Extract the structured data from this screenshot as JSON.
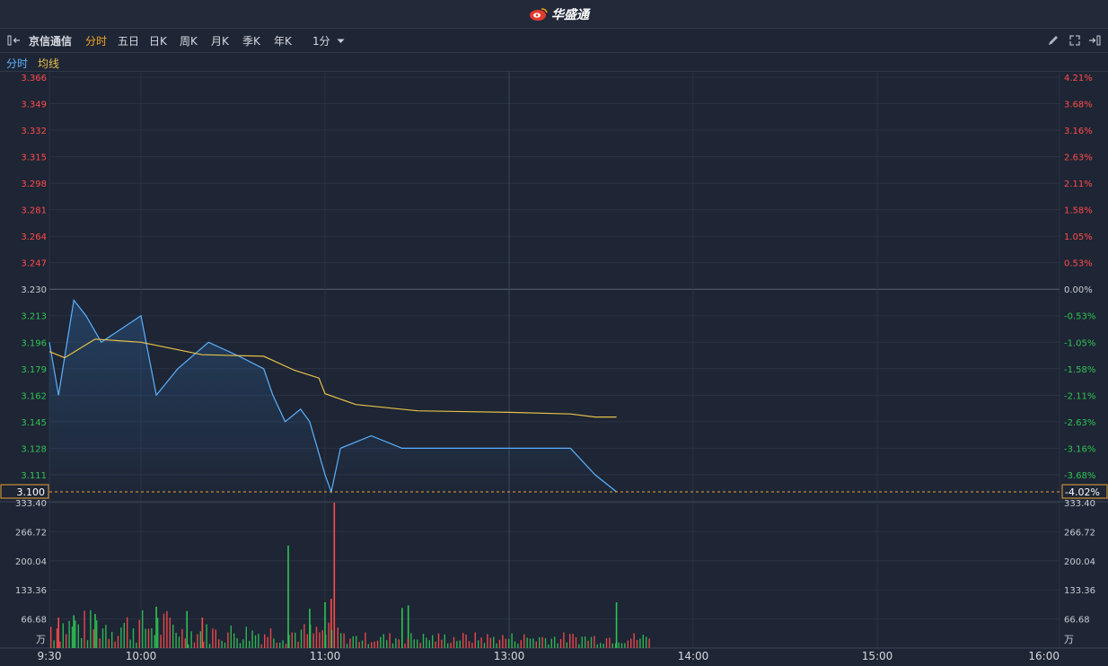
{
  "app": {
    "brand": "华盛通"
  },
  "toolbar": {
    "stock_name": "京信通信",
    "tabs": [
      "分时",
      "五日",
      "日K",
      "周K",
      "月K",
      "季K",
      "年K"
    ],
    "active_tab": "分时",
    "interval": "1分"
  },
  "legend": {
    "intraday": "分时",
    "average": "均线"
  },
  "colors": {
    "background": "#1e2534",
    "price_line": "#5bb2ff",
    "avg_line": "#e6c14b",
    "up": "#ff4b4b",
    "down": "#2fc455",
    "active_tab": "#f5a623",
    "current_price": "#e8a33a"
  },
  "chart_data": [
    {
      "type": "line",
      "series": [
        {
          "name": "分时",
          "x": [
            "9:30",
            "9:33",
            "9:38",
            "9:42",
            "9:47",
            "10:00",
            "10:05",
            "10:12",
            "10:22",
            "10:32",
            "10:40",
            "10:43",
            "10:47",
            "10:52",
            "10:55",
            "11:00",
            "11:02",
            "11:05",
            "11:15",
            "11:25",
            "11:30",
            "13:00",
            "13:20",
            "13:28",
            "13:35"
          ],
          "values": [
            3.196,
            3.162,
            3.223,
            3.213,
            3.196,
            3.213,
            3.162,
            3.179,
            3.196,
            3.187,
            3.179,
            3.162,
            3.145,
            3.153,
            3.145,
            3.111,
            3.1,
            3.128,
            3.136,
            3.128,
            3.128,
            3.128,
            3.128,
            3.111,
            3.1
          ]
        },
        {
          "name": "均线",
          "x": [
            "9:30",
            "9:35",
            "9:45",
            "10:00",
            "10:20",
            "10:40",
            "10:50",
            "10:58",
            "11:00",
            "11:10",
            "11:30",
            "13:00",
            "13:20",
            "13:28",
            "13:35"
          ],
          "values": [
            3.19,
            3.186,
            3.198,
            3.196,
            3.188,
            3.187,
            3.178,
            3.173,
            3.163,
            3.156,
            3.152,
            3.151,
            3.15,
            3.148,
            3.148
          ]
        }
      ],
      "y_ticks_left": [
        "3.366",
        "3.349",
        "3.332",
        "3.315",
        "3.298",
        "3.281",
        "3.264",
        "3.247",
        "3.230",
        "3.213",
        "3.196",
        "3.179",
        "3.162",
        "3.145",
        "3.128",
        "3.111"
      ],
      "y_ticks_right": [
        "4.21%",
        "3.68%",
        "3.16%",
        "2.63%",
        "2.11%",
        "1.58%",
        "1.05%",
        "0.53%",
        "0.00%",
        "-0.53%",
        "-1.05%",
        "-1.58%",
        "-2.11%",
        "-2.63%",
        "-3.16%",
        "-3.68%"
      ],
      "ylim": [
        3.1,
        3.366
      ],
      "prev_close": 3.23,
      "current_price": "3.100",
      "current_change": "-4.02%",
      "grid": true
    },
    {
      "type": "bar",
      "unit": "万",
      "y_ticks": [
        "333.40",
        "266.72",
        "200.04",
        "133.36",
        "66.68"
      ],
      "ylim": [
        0,
        333.4
      ],
      "x_ticks": [
        "9:30",
        "10:00",
        "11:00",
        "13:00",
        "14:00",
        "15:00",
        "16:00"
      ],
      "bars": [
        {
          "x": "10:48",
          "value": 235,
          "dir": "down"
        },
        {
          "x": "11:03",
          "value": 333.4,
          "dir": "up"
        },
        {
          "x": "11:02",
          "value": 113,
          "dir": "up"
        },
        {
          "x": "11:00",
          "value": 105,
          "dir": "down"
        },
        {
          "x": "13:35",
          "value": 105,
          "dir": "down"
        },
        {
          "x": "9:33",
          "value": 70,
          "dir": "up"
        },
        {
          "x": "9:38",
          "value": 75,
          "dir": "down"
        },
        {
          "x": "9:45",
          "value": 78,
          "dir": "down"
        },
        {
          "x": "10:05",
          "value": 95,
          "dir": "down"
        },
        {
          "x": "10:15",
          "value": 85,
          "dir": "down"
        },
        {
          "x": "10:20",
          "value": 70,
          "dir": "up"
        },
        {
          "x": "10:55",
          "value": 90,
          "dir": "down"
        },
        {
          "x": "11:25",
          "value": 92,
          "dir": "down"
        },
        {
          "x": "11:27",
          "value": 98,
          "dir": "down"
        }
      ]
    }
  ]
}
